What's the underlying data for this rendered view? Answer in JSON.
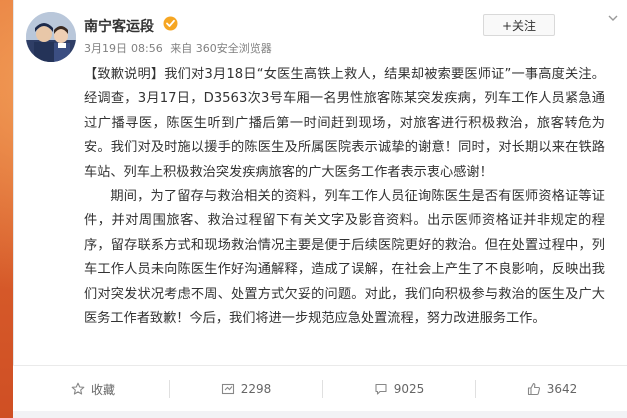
{
  "post": {
    "account_name": "南宁客运段",
    "date": "3月19日",
    "time": "08:56",
    "source": "来自 360安全浏览器",
    "follow_label": "+关注",
    "paragraph1": "【致歉说明】我们对3月18日“女医生高铁上救人，结果却被索要医师证”一事高度关注。经调查，3月17日，D3563次3号车厢一名男性旅客陈某突发疾病，列车工作人员紧急通过广播寻医，陈医生听到广播后第一时间赶到现场，对旅客进行积极救治，旅客转危为安。我们对及时施以援手的陈医生及所属医院表示诚挚的谢意！同时，对长期以来在铁路车站、列车上积极救治突发疾病旅客的广大医务工作者表示衷心感谢！",
    "paragraph2": "期间，为了留存与救治相关的资料，列车工作人员征询陈医生是否有医师资格证等证件，并对周围旅客、救治过程留下有关文字及影音资料。出示医师资格证并非规定的程序，留存联系方式和现场救治情况主要是便于后续医院更好的救治。但在处置过程中，列车工作人员未向陈医生作好沟通解释，造成了误解，在社会上产生了不良影响，反映出我们对突发状况考虑不周、处置方式欠妥的问题。对此，我们向积极参与救治的医生及广大医务工作者致歉！今后，我们将进一步规范应急处置流程，努力改进服务工作。"
  },
  "actions": {
    "favorite_label": "收藏",
    "repost_count": "2298",
    "comment_count": "9025",
    "like_count": "3642"
  },
  "icons": {
    "verified": "verified-badge-icon",
    "favorite": "star-icon",
    "repost": "repost-icon",
    "comment": "comment-icon",
    "like": "thumbs-up-icon",
    "menu": "chevron-down-icon"
  },
  "colors": {
    "background": "#d85a2a",
    "verified_badge": "#f6a623",
    "follow_plus": "#ff8200",
    "text": "#333333",
    "meta": "#808080"
  }
}
